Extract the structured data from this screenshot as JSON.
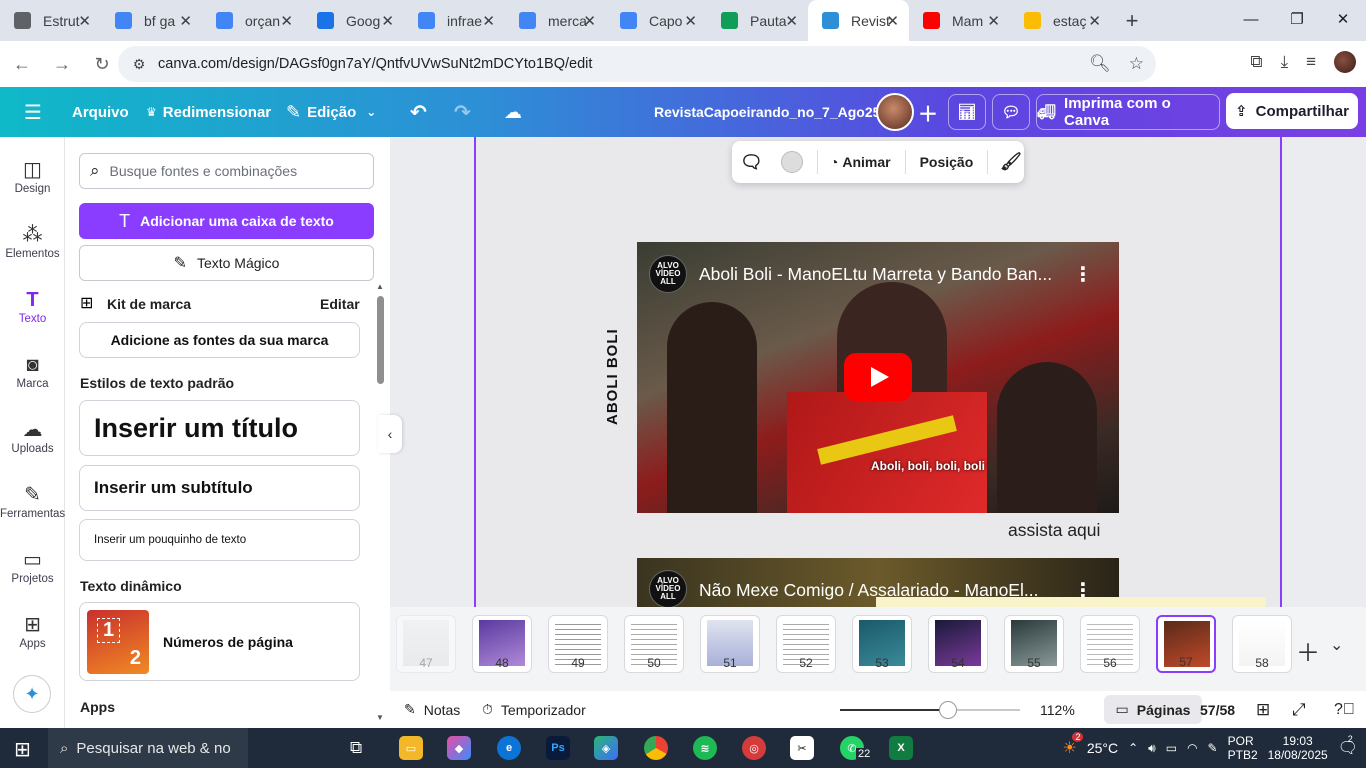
{
  "browser": {
    "tabs": [
      {
        "title": "Estrut",
        "color": "#5f6368"
      },
      {
        "title": "bf ga",
        "color": "#4285f4"
      },
      {
        "title": "orçan",
        "color": "#4285f4"
      },
      {
        "title": "Goog",
        "color": "#1a73e8"
      },
      {
        "title": "infrae",
        "color": "#4285f4"
      },
      {
        "title": "merca",
        "color": "#4285f4"
      },
      {
        "title": "Capo",
        "color": "#4285f4"
      },
      {
        "title": "Pauta",
        "color": "#0f9d58"
      },
      {
        "title": "Revist",
        "color": "#2d8fd6",
        "active": true
      },
      {
        "title": "Mam",
        "color": "#ff0000"
      },
      {
        "title": "estaç",
        "color": "#fbbc04"
      }
    ],
    "url": "canva.com/design/DAGsf0gn7aY/QntfvUVwSuNt2mDCYto1BQ/edit"
  },
  "header": {
    "menu_icon": "hamburger-icon",
    "file": "Arquivo",
    "resize": "Redimensionar",
    "edit": "Edição",
    "doc_title": "RevistaCapoeirando_no_7_Ago25",
    "print": "Imprima com o Canva",
    "share": "Compartilhar"
  },
  "rail": [
    {
      "label": "Design",
      "icon": "design-icon"
    },
    {
      "label": "Elementos",
      "icon": "elements-icon"
    },
    {
      "label": "Texto",
      "icon": "text-icon",
      "active": true
    },
    {
      "label": "Marca",
      "icon": "brand-icon"
    },
    {
      "label": "Uploads",
      "icon": "upload-icon"
    },
    {
      "label": "Ferramentas",
      "icon": "tools-icon"
    },
    {
      "label": "Projetos",
      "icon": "folder-icon"
    },
    {
      "label": "Apps",
      "icon": "apps-icon"
    }
  ],
  "panel": {
    "search_placeholder": "Busque fontes e combinações",
    "add_textbox": "Adicionar uma caixa de texto",
    "magic_text": "Texto Mágico",
    "brand_kit": "Kit de marca",
    "brand_edit": "Editar",
    "brand_fonts": "Adicione as fontes da sua marca",
    "default_styles": "Estilos de texto padrão",
    "title": "Inserir um título",
    "subtitle": "Inserir um subtítulo",
    "body": "Inserir um pouquinho de texto",
    "dynamic_text": "Texto dinâmico",
    "page_numbers": "Números de página",
    "page_numbers_thumb_a": "1",
    "page_numbers_thumb_b": "2",
    "apps": "Apps"
  },
  "toolbar": {
    "animate": "Animar",
    "position": "Posição"
  },
  "canvas": {
    "vertical_title": "ABOLI BOLI",
    "video1_title": "Aboli Boli - ManoELtu Marreta y Bando Ban...",
    "video1_caption": "Aboli, boli, boli, boli",
    "channel_logo": "ALVO VÍDEO ALL",
    "watch_here": "assista aqui",
    "video2_title": "Não Mexe Comigo / Assalariado - ManoEl..."
  },
  "pages": {
    "thumbs": [
      "47",
      "48",
      "49",
      "50",
      "51",
      "52",
      "53",
      "54",
      "55",
      "56",
      "57",
      "58"
    ],
    "active": "57"
  },
  "footer": {
    "notes": "Notas",
    "timer": "Temporizador",
    "zoom": "112%",
    "zoom_fraction": 0.6,
    "pages": "Páginas",
    "page_count": "57/58"
  },
  "taskbar": {
    "search": "Pesquisar na web & no",
    "whatsapp_badge": "22",
    "weather_badge": "2",
    "temperature": "25°C",
    "lang": "POR",
    "layout": "PTB2",
    "time": "19:03",
    "date": "18/08/2025",
    "notif_count": "2"
  }
}
